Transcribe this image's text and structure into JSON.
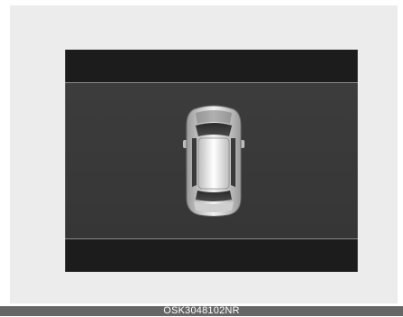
{
  "caption": {
    "code": "OSK3048102NR"
  },
  "display": {
    "vehicle_icon": "car-top-view-icon"
  }
}
